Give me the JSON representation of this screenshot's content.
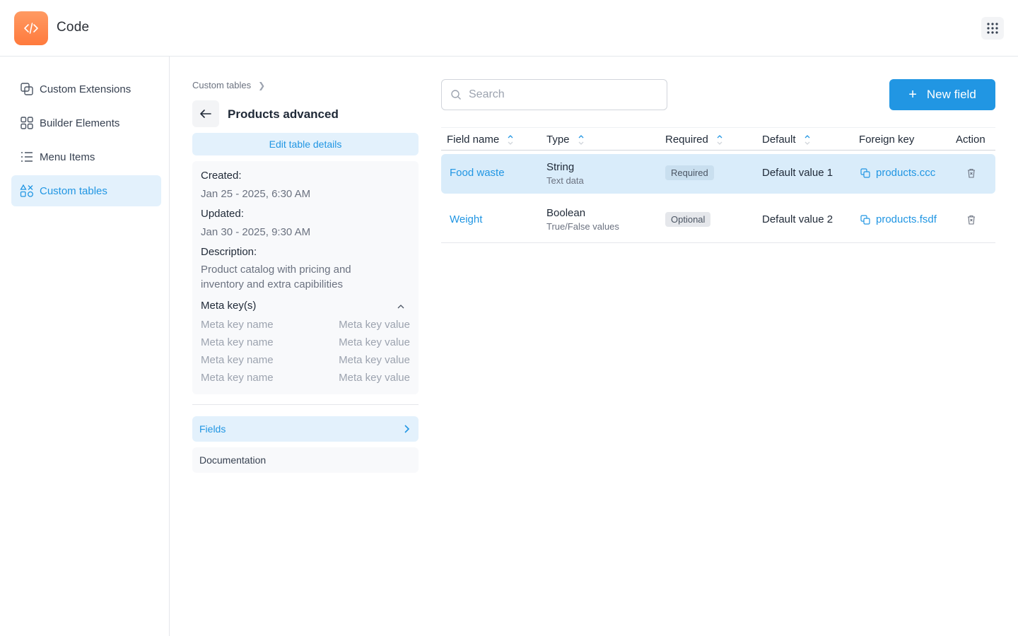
{
  "app": {
    "name": "Code"
  },
  "sidebar": {
    "items": [
      {
        "label": "Custom Extensions",
        "icon": "extensions-icon"
      },
      {
        "label": "Builder Elements",
        "icon": "grid-icon"
      },
      {
        "label": "Menu Items",
        "icon": "list-icon"
      },
      {
        "label": "Custom tables",
        "icon": "shapes-icon",
        "active": true
      }
    ]
  },
  "details": {
    "breadcrumb": "Custom tables",
    "title": "Products advanced",
    "edit_label": "Edit table details",
    "created_label": "Created:",
    "created_value": "Jan 25 - 2025, 6:30 AM",
    "updated_label": "Updated:",
    "updated_value": "Jan 30 - 2025, 9:30 AM",
    "description_label": "Description:",
    "description_line1": "Product catalog with pricing and",
    "description_line2": "inventory and extra capibilities",
    "meta_label": "Meta key(s)",
    "meta": [
      {
        "name": "Meta key name",
        "value": "Meta key value"
      },
      {
        "name": "Meta key name",
        "value": "Meta key value"
      },
      {
        "name": "Meta key name",
        "value": "Meta key value"
      },
      {
        "name": "Meta key name",
        "value": "Meta key value"
      }
    ],
    "tabs": [
      {
        "label": "Fields",
        "active": true
      },
      {
        "label": "Documentation",
        "active": false
      }
    ]
  },
  "toolbar": {
    "search_placeholder": "Search",
    "new_label": "New field"
  },
  "table": {
    "headers": {
      "field_name": "Field name",
      "type": "Type",
      "required": "Required",
      "default": "Default",
      "foreign_key": "Foreign key",
      "action": "Action"
    },
    "rows": [
      {
        "name": "Food waste",
        "type": "String",
        "type_desc": "Text data",
        "required": "Required",
        "default": "Default value 1",
        "foreign_key": "products.ccc",
        "selected": true
      },
      {
        "name": "Weight",
        "type": "Boolean",
        "type_desc": "True/False values",
        "required": "Optional",
        "default": "Default value 2",
        "foreign_key": "products.fsdf",
        "selected": false
      }
    ]
  },
  "colors": {
    "accent": "#2196e3",
    "logo": "#ff8a4c",
    "selected_row": "#d9ecfa",
    "active_bg": "#e3f1fc"
  }
}
